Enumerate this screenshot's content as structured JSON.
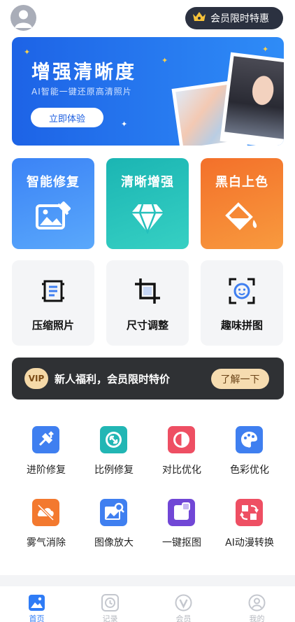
{
  "header": {
    "member_offer": "会员限时特惠",
    "avatar_icon": "user-avatar-icon",
    "crown_icon": "crown-icon"
  },
  "banner": {
    "title": "增强清晰度",
    "subtitle": "AI智能一键还原高清照片",
    "button": "立即体验"
  },
  "feature_tiles": [
    {
      "label": "智能修复",
      "icon": "image-repair-icon",
      "color": "#3d86f5"
    },
    {
      "label": "清晰增强",
      "icon": "diamond-icon",
      "color": "#24c1bd"
    },
    {
      "label": "黑白上色",
      "icon": "paint-bucket-icon",
      "color": "#f57c2a"
    }
  ],
  "tools": [
    {
      "label": "压缩照片",
      "icon": "compress-icon"
    },
    {
      "label": "尺寸调整",
      "icon": "crop-icon"
    },
    {
      "label": "趣味拼图",
      "icon": "face-scan-icon"
    }
  ],
  "vip_bar": {
    "badge": "VIP",
    "text": "新人福利，会员限时特价",
    "button": "了解一下"
  },
  "grid": [
    {
      "label": "进阶修复",
      "icon": "tools-icon",
      "color": "#3f7ff0"
    },
    {
      "label": "比例修复",
      "icon": "ratio-icon",
      "color": "#22b6b4"
    },
    {
      "label": "对比优化",
      "icon": "contrast-icon",
      "color": "#ee4f63"
    },
    {
      "label": "色彩优化",
      "icon": "palette-icon",
      "color": "#3f7ff0"
    },
    {
      "label": "雾气消除",
      "icon": "haze-remove-icon",
      "color": "#f3792f"
    },
    {
      "label": "图像放大",
      "icon": "zoom-image-icon",
      "color": "#3f7ff0"
    },
    {
      "label": "一键抠图",
      "icon": "cutout-icon",
      "color": "#7147d6"
    },
    {
      "label": "AI动漫转换",
      "icon": "anime-convert-icon",
      "color": "#ee4f63"
    }
  ],
  "tabbar": [
    {
      "label": "首页",
      "icon": "home-image-icon",
      "active": true
    },
    {
      "label": "记录",
      "icon": "clock-icon",
      "active": false
    },
    {
      "label": "会员",
      "icon": "vip-v-icon",
      "active": false
    },
    {
      "label": "我的",
      "icon": "profile-icon",
      "active": false
    }
  ],
  "colors": {
    "primary": "#2f7cf6",
    "dark_pill": "#2b3140",
    "vip_gold": "#f6dcb0"
  }
}
